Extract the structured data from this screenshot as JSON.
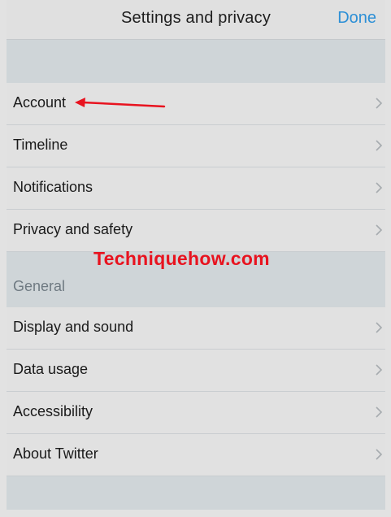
{
  "navbar": {
    "title": "Settings and privacy",
    "done_label": "Done"
  },
  "sections": [
    {
      "header": "",
      "items": [
        {
          "label": "Account"
        },
        {
          "label": "Timeline"
        },
        {
          "label": "Notifications"
        },
        {
          "label": "Privacy and safety"
        }
      ]
    },
    {
      "header": "General",
      "items": [
        {
          "label": "Display and sound"
        },
        {
          "label": "Data usage"
        },
        {
          "label": "Accessibility"
        },
        {
          "label": "About Twitter"
        }
      ]
    }
  ],
  "annotation": {
    "watermark": "Techniquehow.com",
    "arrow_color": "#e8131f"
  },
  "icons": {
    "row_disclosure": "chevron-right-icon"
  },
  "colors": {
    "accent": "#2c8fd6",
    "row_background": "#e1e1e1",
    "group_background": "#cfd5d8"
  }
}
